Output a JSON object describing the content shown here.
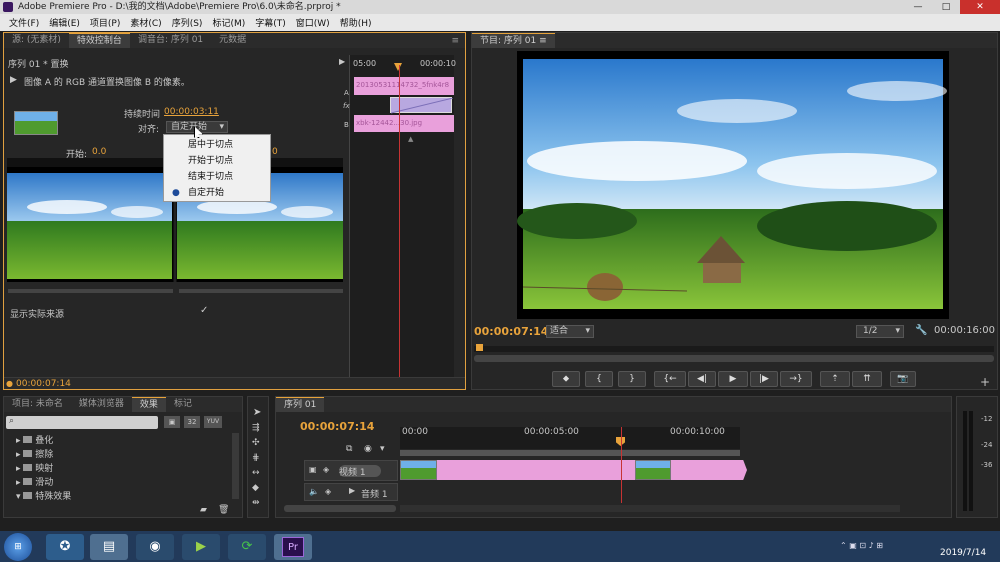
{
  "window": {
    "title": "Adobe Premiere Pro - D:\\我的文档\\Adobe\\Premiere Pro\\6.0\\未命名.prproj *",
    "controls": [
      "—",
      "□",
      "✕"
    ]
  },
  "menu": [
    "文件(F)",
    "编辑(E)",
    "项目(P)",
    "素材(C)",
    "序列(S)",
    "标记(M)",
    "字幕(T)",
    "窗口(W)",
    "帮助(H)"
  ],
  "source_panel": {
    "tabs": [
      "源: (无素材)",
      "特效控制台",
      "调音台: 序列 01",
      "元数据"
    ],
    "sequence_label": "序列 01 * 置换",
    "description": "图像 A 的 RGB 通道置换图像 B 的像素。",
    "duration_label": "持续时间",
    "duration_value": "00:00:03:11",
    "align_label": "对齐:",
    "align_value": "自定开始",
    "start_label": "开始:",
    "start_value": "0.0",
    "end_value": "0",
    "show_source_label": "显示实际来源",
    "current_time": "00:00:07:14",
    "mini_timeline": {
      "time_start": "05:00",
      "time_end": "00:00:10",
      "clip_a": "20130531114732_5fnk4r8",
      "clip_b": "xbk-12442...30.jpg",
      "track_a": "A",
      "track_b": "B",
      "fx": "fx"
    }
  },
  "align_dropdown": {
    "options": [
      "居中于切点",
      "开始于切点",
      "结束于切点",
      "自定开始"
    ],
    "selected_index": 3
  },
  "program_panel": {
    "tab": "节目: 序列 01",
    "current_time": "00:00:07:14",
    "fit": "适合",
    "resolution": "1/2",
    "duration": "00:00:16:00",
    "transport": [
      "mark-in",
      "mark-in-point",
      "mark-out-point",
      "go-to-in",
      "step-back",
      "play",
      "step-forward",
      "go-to-out",
      "lift",
      "extract",
      "export-frame"
    ]
  },
  "project_panel": {
    "tabs": [
      "项目: 未命名",
      "媒体浏览器",
      "效果",
      "标记"
    ],
    "presets": [
      "32",
      "YUV"
    ],
    "folders": [
      "叠化",
      "擦除",
      "映射",
      "滑动",
      "特殊效果"
    ]
  },
  "timeline_panel": {
    "tab": "序列 01",
    "current_time": "00:00:07:14",
    "ruler": [
      "00:00",
      "00:00:05:00",
      "00:00:10:00"
    ],
    "video_track": "视频 1",
    "audio_track": "音频 1"
  },
  "audio_meter": {
    "labels": [
      "-12",
      "-24",
      "-36"
    ]
  },
  "taskbar": {
    "clock_time": "",
    "date": "2019/7/14"
  },
  "colors": {
    "accent": "#e8a33b",
    "clip_pink": "#e9a0db",
    "playhead": "#c73333"
  }
}
